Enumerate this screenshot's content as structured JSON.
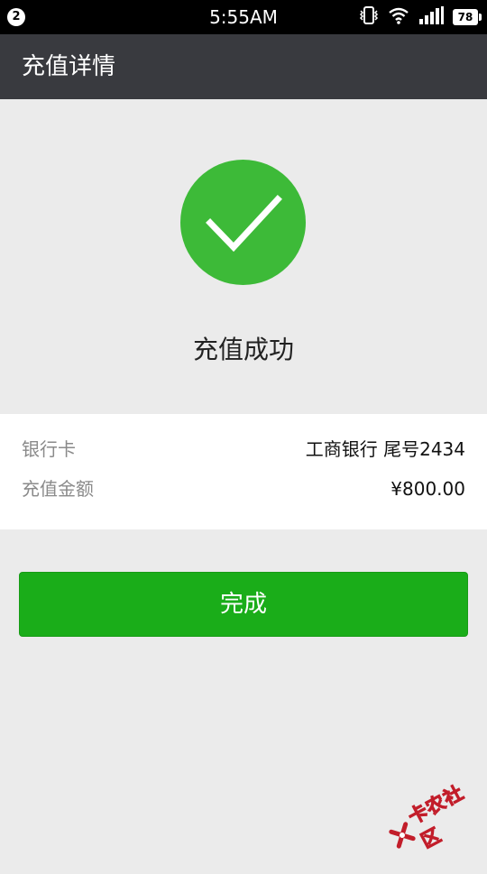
{
  "status_bar": {
    "notification_count": "2",
    "time": "5:55AM",
    "battery_level": "78",
    "icons": [
      "notification-badge-icon",
      "vibrate-icon",
      "wifi-icon",
      "signal-icon",
      "battery-icon"
    ]
  },
  "app_bar": {
    "title": "充值详情"
  },
  "result": {
    "icon": "checkmark-icon",
    "message": "充值成功"
  },
  "details": [
    {
      "label": "银行卡",
      "value": "工商银行 尾号2434"
    },
    {
      "label": "充值金额",
      "value": "¥800.00"
    }
  ],
  "actions": {
    "done_label": "完成"
  },
  "watermark": {
    "text": "卡农社区"
  },
  "colors": {
    "status_bar_bg": "#000000",
    "app_bar_bg": "#393a3f",
    "page_bg": "#ebebeb",
    "success_green": "#3dba38",
    "button_green": "#1aad19",
    "watermark_red": "#c21d2a"
  }
}
